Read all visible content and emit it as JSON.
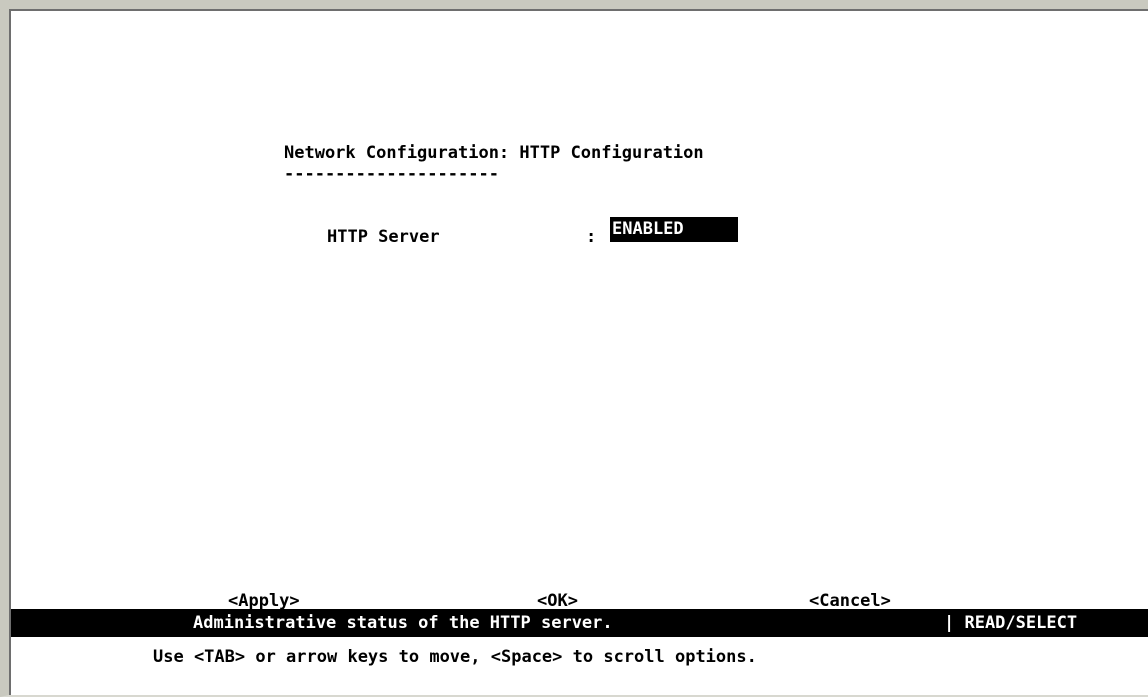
{
  "screen": {
    "title": "Network Configuration: HTTP Configuration",
    "title_underline": "---------------------"
  },
  "fields": [
    {
      "label": "HTTP Server",
      "separator": ":",
      "value": "ENABLED"
    }
  ],
  "buttons": {
    "apply": "<Apply>",
    "ok": "<OK>",
    "cancel": "<Cancel>"
  },
  "status_bar": {
    "description": "Administrative status of the HTTP server.",
    "mode": "| READ/SELECT"
  },
  "help_text": "Use <TAB> or arrow keys to move, <Space> to scroll options.",
  "colors": {
    "background": "#ffffff",
    "foreground": "#000000",
    "highlight_bg": "#000000",
    "highlight_fg": "#ffffff",
    "frame": "#c9c9bf"
  }
}
